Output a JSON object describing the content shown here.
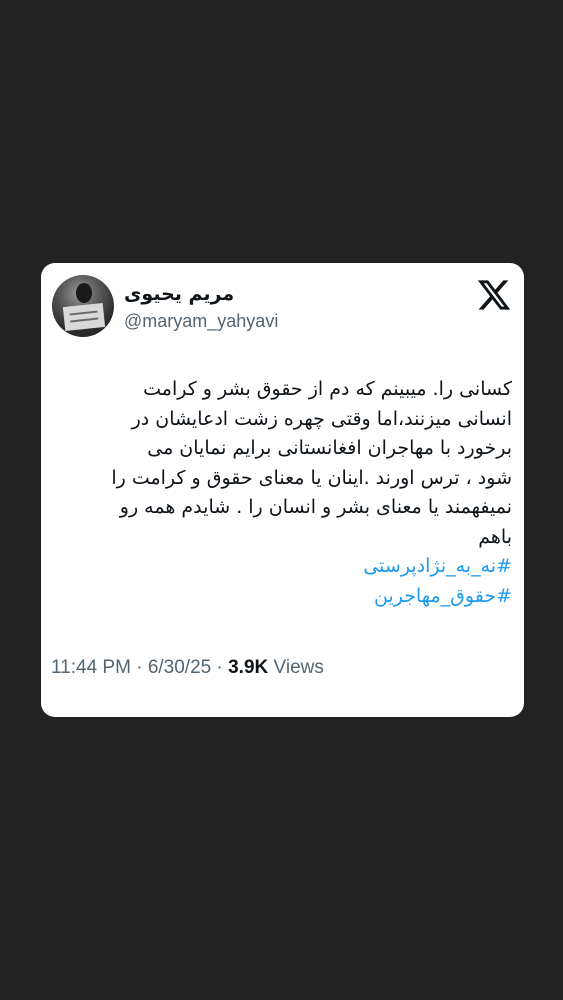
{
  "tweet": {
    "author": {
      "display_name": "مریم یحیوی",
      "handle": "@maryam_yahyavi",
      "avatar_icon": "profile-photo"
    },
    "platform_icon": "x-logo-icon",
    "text_lines": [
      "کسانی را. میبینم که دم از حقوق بشر و کرامت",
      "انسانی میزنند،اما  وقتی چهره زشت ادعایشان در",
      "برخورد با مهاجران افغانستانی برایم نمایان می",
      "شود ، ترس اورند .اینان یا معنای حقوق و کرامت را",
      "نمیفهمند یا معنای بشر و انسان را . شایدم همه رو",
      "باهم"
    ],
    "hashtags": [
      "#نه_به_نژادپرستی",
      "#حقوق_مهاجرین"
    ],
    "time": "11:44 PM",
    "separator": "·",
    "date": "6/30/25",
    "views_count": "3.9K",
    "views_label": "Views"
  },
  "colors": {
    "background": "#222222",
    "card": "#ffffff",
    "text": "#0f1419",
    "muted": "#536471",
    "hashtag": "#1d9bf0"
  }
}
